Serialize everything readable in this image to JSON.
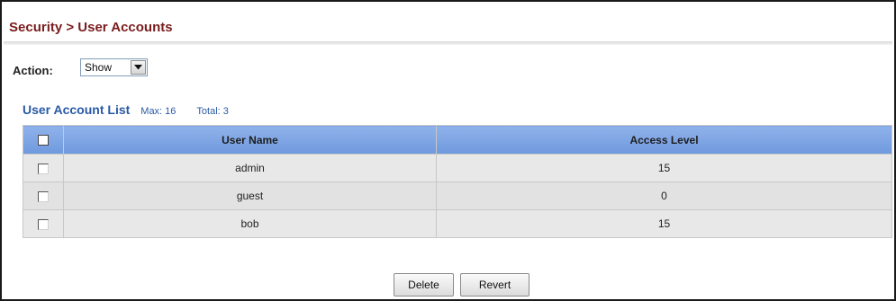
{
  "breadcrumb": {
    "title": "Security > User Accounts"
  },
  "action": {
    "label": "Action:",
    "selected": "Show"
  },
  "list": {
    "title": "User Account List",
    "max_label": "Max: 16",
    "total_label": "Total: 3"
  },
  "table": {
    "headers": {
      "user_name": "User Name",
      "access_level": "Access Level"
    },
    "rows": [
      {
        "user_name": "admin",
        "access_level": "15"
      },
      {
        "user_name": "guest",
        "access_level": "0"
      },
      {
        "user_name": "bob",
        "access_level": "15"
      }
    ]
  },
  "buttons": {
    "delete": "Delete",
    "revert": "Revert"
  },
  "colors": {
    "title": "#7a1c1c",
    "list_title": "#2a5aa6",
    "header_bg": "#7ea6e4",
    "row_bg": "#e6e6e6"
  }
}
